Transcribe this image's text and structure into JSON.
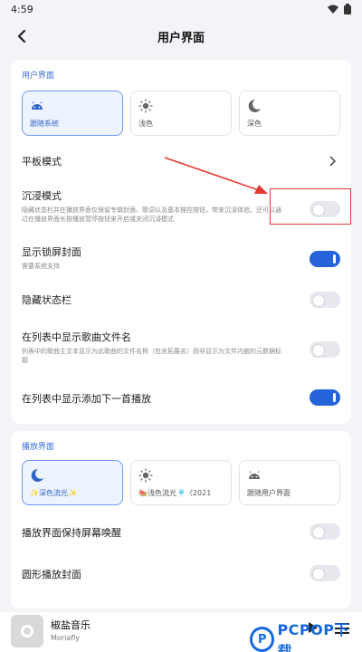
{
  "status_bar": {
    "time": "4:59"
  },
  "header": {
    "title": "用户界面"
  },
  "sections": {
    "ui": {
      "title": "用户界面",
      "theme_modes": [
        {
          "label": "跟随系统",
          "icon": "android-icon",
          "selected": true
        },
        {
          "label": "浅色",
          "icon": "sun-icon",
          "selected": false
        },
        {
          "label": "深色",
          "icon": "moon-icon",
          "selected": false
        }
      ],
      "tablet_mode": {
        "title": "平板模式"
      },
      "immersive": {
        "title": "沉浸模式",
        "desc": "隐藏状态栏并在播放界面仅保留专辑封面、歌词以及基本操控按钮，带来沉浸体验。还可以通过在播放界面长按播放暂停按钮来开启或关闭沉浸模式",
        "enabled": false
      },
      "lockscreen_cover": {
        "title": "显示锁屏封面",
        "desc": "需要系统支持",
        "enabled": true
      },
      "hide_statusbar": {
        "title": "隐藏状态栏",
        "enabled": false
      },
      "show_filename": {
        "title": "在列表中显示歌曲文件名",
        "desc": "列表中的歌曲主文本显示为此歌曲的文件名称（包含拓展名）而非显示为文件内嵌的元数据标题",
        "enabled": false
      },
      "add_next": {
        "title": "在列表中显示添加下一首播放",
        "enabled": true
      }
    },
    "player": {
      "title": "播放界面",
      "player_modes": [
        {
          "label": "✨深色流光✨",
          "icon": "moon-icon",
          "selected": true
        },
        {
          "label": "🍉浅色流光🎐（2021",
          "icon": "sun-icon",
          "selected": false
        },
        {
          "label": "跟随用户界面",
          "icon": "android-icon",
          "selected": false
        }
      ],
      "keep_awake": {
        "title": "播放界面保持屏幕唤醒",
        "enabled": false
      },
      "round_cover": {
        "title": "圆形播放封面",
        "enabled": false
      }
    }
  },
  "mini_player": {
    "song": "椒盐音乐",
    "artist": "Moriafly"
  },
  "watermark": {
    "logo_letter": "P",
    "text": "PCPOP下载"
  },
  "colors": {
    "accent": "#2463d9",
    "annotation": "#e53935",
    "section_title": "#3b6fd8"
  }
}
